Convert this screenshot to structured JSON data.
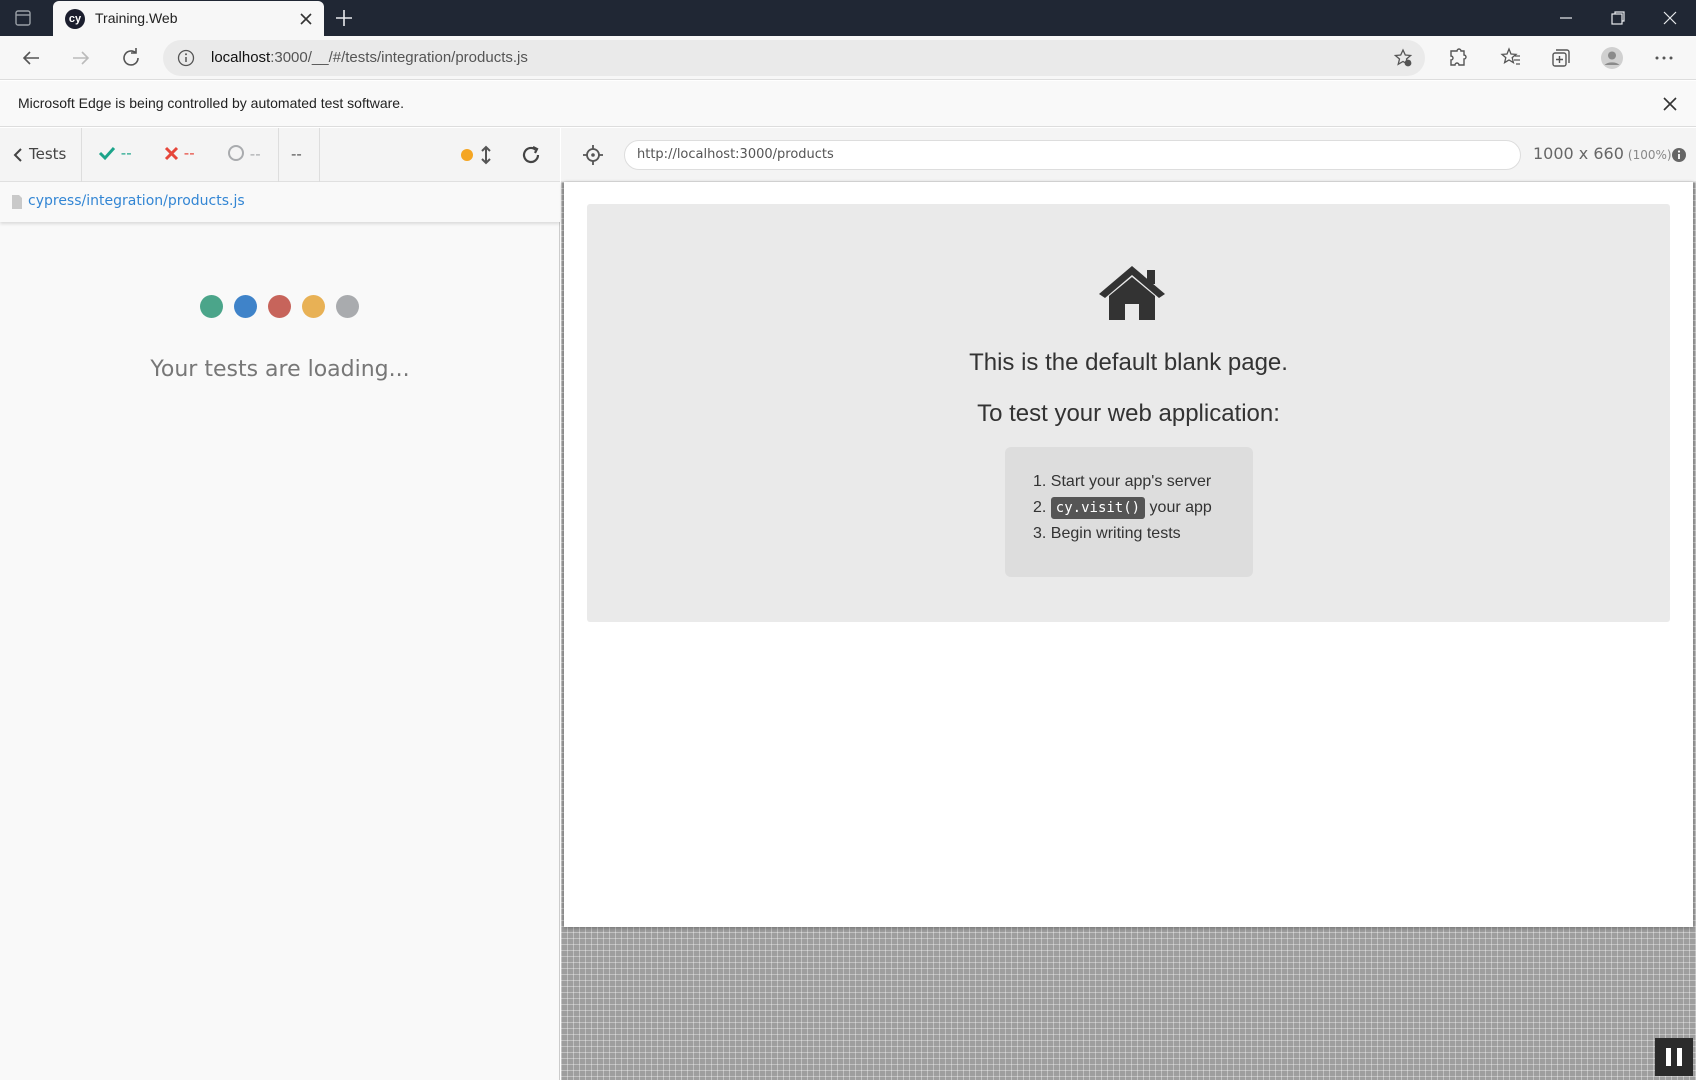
{
  "browser": {
    "tab_title": "Training.Web",
    "tab_favicon_text": "cy",
    "address_host": "localhost",
    "address_rest": ":3000/__/#/tests/integration/products.js",
    "infobar_text": "Microsoft Edge is being controlled by automated test software."
  },
  "reporter": {
    "tests_label": "Tests",
    "passed": "--",
    "failed": "--",
    "pending": "--",
    "duration": "--",
    "spec_path": "cypress/integration/products.js",
    "loading_text": "Your tests are loading...",
    "loader_colors": [
      "#4ba58a",
      "#3f83c9",
      "#c7645b",
      "#e8b155",
      "#a9abae"
    ]
  },
  "aut": {
    "url": "http://localhost:3000/products",
    "viewport": "1000 x 660",
    "scale": "(100%)",
    "blank_title": "This is the default blank page.",
    "blank_subtitle": "To test your web application:",
    "steps": [
      {
        "num": "1.",
        "text": "Start your app's server"
      },
      {
        "num": "2.",
        "code": "cy.visit()",
        "text": "your app"
      },
      {
        "num": "3.",
        "text": "Begin writing tests"
      }
    ]
  },
  "colors": {
    "pass": "#1ca48a",
    "fail": "#e6463a",
    "link": "#3386d4",
    "running": "#f5a623"
  }
}
